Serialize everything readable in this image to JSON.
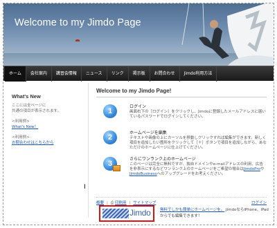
{
  "header": {
    "title": "Welcome to my Jimdo Page"
  },
  "nav": {
    "items": [
      "ホーム",
      "会社案内",
      "講習会情報",
      "ニュース",
      "リンク",
      "掲示板",
      "お問合わせ",
      "Jimdo利用方法"
    ]
  },
  "sidebar": {
    "heading": "What's New",
    "intro_line1": "ここには全ページに",
    "intro_line2": "共通の項目が表示されます。",
    "example1_label": "<利用例>",
    "example1_link": "What's New！",
    "example2_label": "<利用例>",
    "example2_link": "お問合わせはこちらから"
  },
  "main": {
    "title": "Welcome to my Jimdo Page!",
    "steps": [
      {
        "number": "1",
        "heading": "ログイン",
        "body": "画面右下の［ログイン］をクリックし、Jimdoに登録したメールアドレスに届いているパスワードでログインしてください。"
      },
      {
        "number": "2",
        "heading": "ホームページを編集",
        "body": "テキストや画像の上にカーソルを移動しクリックすれば編集ができます。新しく項目を追加したい箇所をクリックして［＋］ボタンで項目を追加しながら、あなただけのホームページに仕上げてください。"
      },
      {
        "heading": "さらにワンランク上のホームページ",
        "body": "このページは完全に無料ですが、独自ドメインやe-mailアドレスの利用、広告を非表示にするなどワンランク上のホームページをご希望の場合は",
        "link1": "JimdoPro",
        "joiner": "や",
        "link2": "JimdoBusiness",
        "tail": "へのアップグレードをお考えください。"
      }
    ]
  },
  "footer": {
    "link1": "概要",
    "link2": "印刷用",
    "link3": "サイトマップ",
    "login": "ログイン"
  },
  "banner": {
    "logo_text": "Jimdo",
    "promo_link": "無料でしかも簡単にホームページを。",
    "promo_text1": "JimdoならiPhone、iPad",
    "promo_text2": "からでも編集できます！"
  },
  "colors": {
    "nav_bg": "#1a1a1a",
    "link": "#1a55b5",
    "banner_border": "#e01010",
    "step_circle": "#3c8fe0"
  }
}
